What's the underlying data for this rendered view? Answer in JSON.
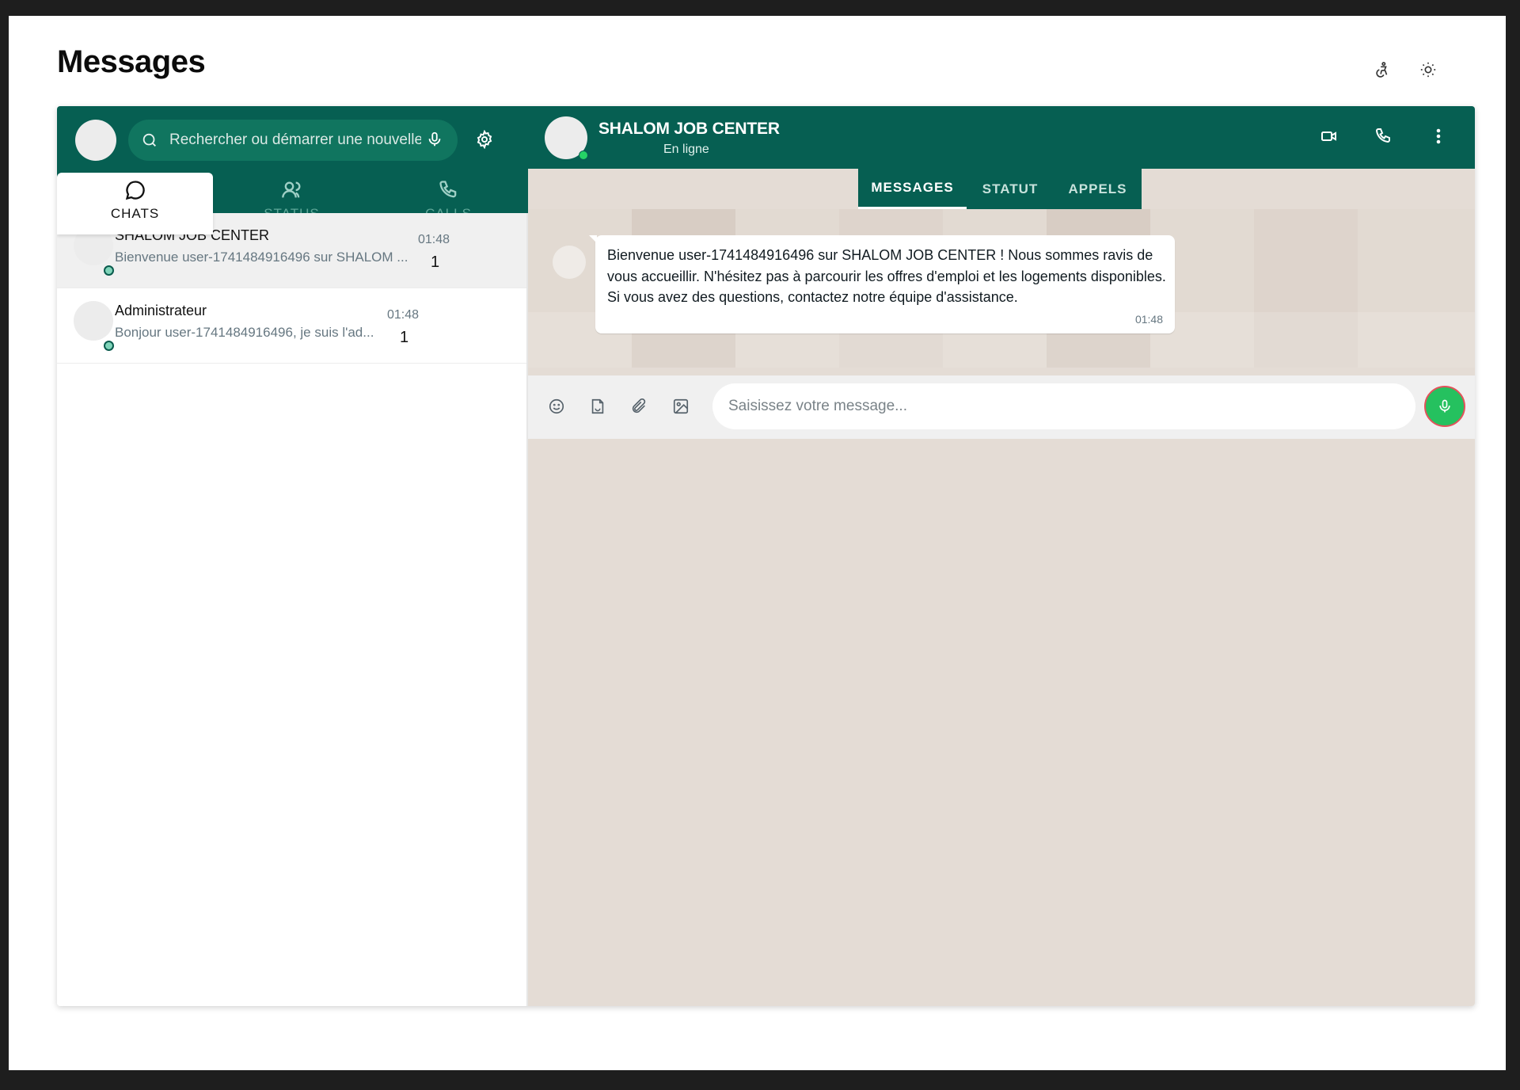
{
  "page": {
    "title": "Messages",
    "icons": [
      "accessibility-icon",
      "sun-icon"
    ]
  },
  "sidebar": {
    "search": {
      "placeholder": "Rechercher ou démarrer une nouvelle discussion"
    },
    "tabs": [
      {
        "label": "CHATS",
        "icon": "chat-bubble-icon",
        "active": true
      },
      {
        "label": "STATUS",
        "icon": "users-icon",
        "active": false
      },
      {
        "label": "CALLS",
        "icon": "phone-icon",
        "active": false
      }
    ],
    "chats": [
      {
        "name": "SHALOM JOB CENTER",
        "preview": "Bienvenue user-1741484916496 sur SHALOM ...",
        "time": "01:48",
        "unread": "1",
        "selected": true
      },
      {
        "name": "Administrateur",
        "preview": "Bonjour user-1741484916496, je suis l'ad...",
        "time": "01:48",
        "unread": "1",
        "selected": false
      }
    ]
  },
  "conversation": {
    "contact_name": "SHALOM JOB CENTER",
    "contact_status": "En ligne",
    "header_icons": [
      "video-icon",
      "phone-icon",
      "more-vertical-icon"
    ],
    "tabs": [
      {
        "label": "MESSAGES",
        "active": true
      },
      {
        "label": "STATUT",
        "active": false
      },
      {
        "label": "APPELS",
        "active": false
      }
    ],
    "messages": [
      {
        "text": "Bienvenue user-1741484916496 sur SHALOM JOB CENTER ! Nous sommes ravis de vous accueillir. N'hésitez pas à parcourir les offres d'emploi et les logements disponibles. Si vous avez des questions, contactez notre équipe d'assistance.",
        "time": "01:48"
      }
    ],
    "composer": {
      "placeholder": "Saisissez votre message...",
      "icons": [
        "emoji-icon",
        "sticker-icon",
        "paperclip-icon",
        "image-icon",
        "mic-icon"
      ]
    }
  },
  "colors": {
    "header_green": "#065f52",
    "chat_background": "#e4dcd5",
    "send_button": "#25c15f"
  }
}
